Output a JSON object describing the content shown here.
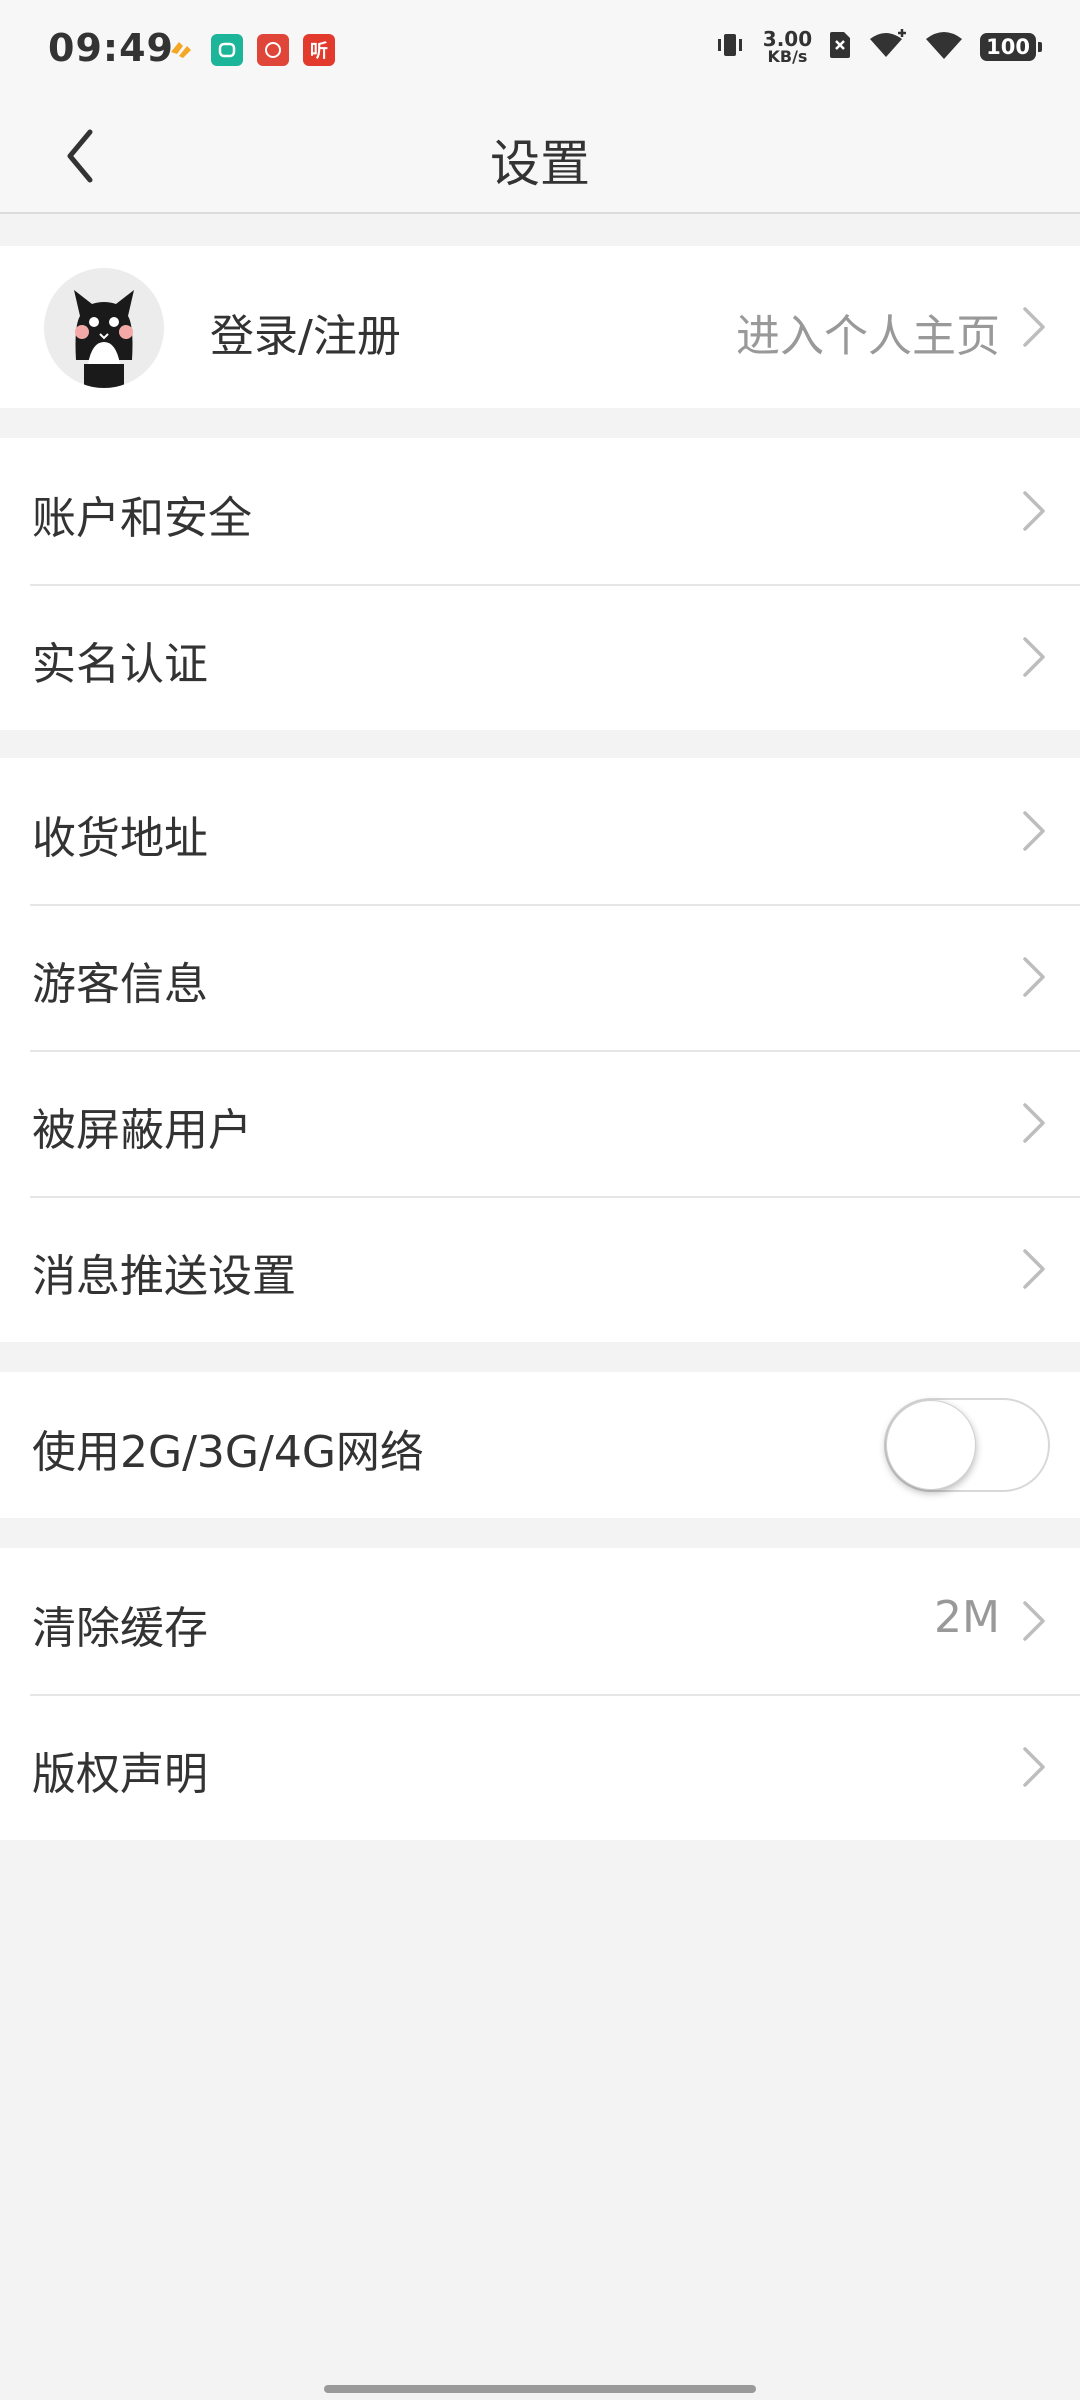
{
  "status_bar": {
    "time": "09:49",
    "net_speed_value": "3.00",
    "net_speed_unit": "KB/s",
    "battery": "100",
    "notif_icon_3": "听"
  },
  "header": {
    "title": "设置"
  },
  "profile": {
    "label": "登录/注册",
    "link": "进入个人主页"
  },
  "section1": [
    {
      "label": "账户和安全"
    },
    {
      "label": "实名认证"
    }
  ],
  "section2": [
    {
      "label": "收货地址"
    },
    {
      "label": "游客信息"
    },
    {
      "label": "被屏蔽用户"
    },
    {
      "label": "消息推送设置"
    }
  ],
  "network": {
    "label": "使用2G/3G/4G网络",
    "enabled": false
  },
  "section4": [
    {
      "label": "清除缓存",
      "value": "2M"
    },
    {
      "label": "版权声明"
    }
  ],
  "colors": {
    "divider": "#e6e6e6",
    "background": "#f3f3f3",
    "chevron": "#bdbdbd"
  }
}
